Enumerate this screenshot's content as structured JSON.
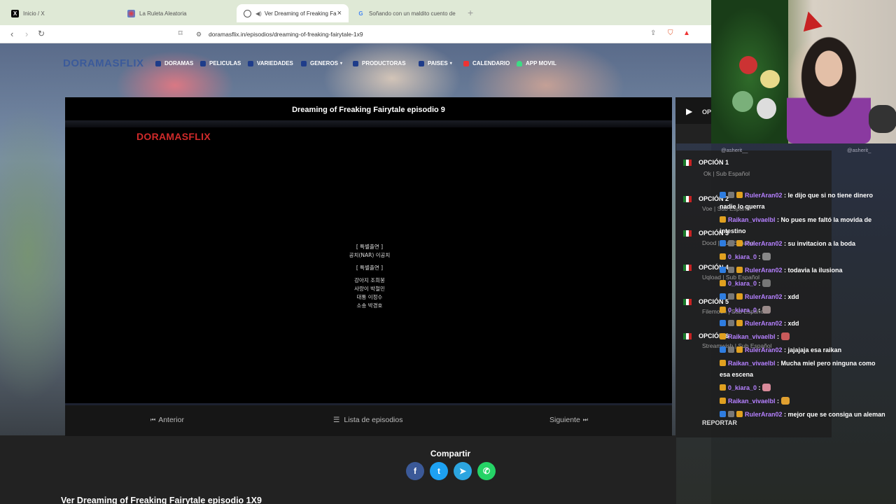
{
  "browser": {
    "tabs": [
      {
        "label": "Inicio / X",
        "icon": "x-logo-icon"
      },
      {
        "label": "La Ruleta Aleatoria",
        "icon": "roulette-icon"
      },
      {
        "label": "Ver Dreaming of Freaking Fa",
        "icon": "globe-icon",
        "active": true
      },
      {
        "label": "Soñando con un maldito cuento de",
        "icon": "google-icon"
      }
    ],
    "new_tab": "+",
    "url": "doramasflix.in/episodios/dreaming-of-freaking-fairytale-1x9"
  },
  "site": {
    "logo": "DORAMASFLIX",
    "menu": [
      "DORAMAS",
      "PELICULAS",
      "VARIEDADES",
      "GENEROS",
      "PRODUCTORAS",
      "PAISES",
      "CALENDARIO",
      "APP MOVIL"
    ]
  },
  "player": {
    "title": "Dreaming of Freaking Fairytale episodio 9",
    "watermark": "DORAMASFLIX",
    "credits": [
      "[ 특별출연 ]",
      "공치(NAR)    이공치",
      "[ 특별출연 ]",
      "강아지    조희봉",
      "사랑이    박철민",
      "대통    이정수",
      "소송    박경호"
    ]
  },
  "pager": {
    "prev": "Anterior",
    "list": "Lista de episodios",
    "next": "Siguiente"
  },
  "options_panel": {
    "head": "OP",
    "items": [
      {
        "label": "OPCIÓN 1",
        "sub": "Ok | Sub Español"
      },
      {
        "label": "OPCIÓN 2",
        "sub": "Voe | Sub Español"
      },
      {
        "label": "OPCIÓN 3",
        "sub": "Dood | Sub Español"
      },
      {
        "label": "OPCIÓN 4",
        "sub": "Uqload | Sub Español"
      },
      {
        "label": "OPCIÓN 5",
        "sub": "Filemoon | Sub Español"
      },
      {
        "label": "OPCIÓN 6",
        "sub": "Streamwish | Sub Español"
      }
    ],
    "report": "REPORTAR"
  },
  "share": {
    "title": "Compartir",
    "buttons": [
      {
        "name": "facebook",
        "glyph": "f",
        "color": "#3b5998"
      },
      {
        "name": "twitter",
        "glyph": "t",
        "color": "#1da1f2"
      },
      {
        "name": "telegram",
        "glyph": "➤",
        "color": "#2ca5e0"
      },
      {
        "name": "whatsapp",
        "glyph": "✆",
        "color": "#25d366"
      }
    ]
  },
  "page_heading": "Ver Dreaming of Freaking Fairytale episodio 1X9",
  "stream": {
    "handles": [
      "@asherit__",
      "@asherit_"
    ],
    "chat": [
      {
        "user": "RulerAran02",
        "color": "#b580ff",
        "text": ": le dijo que si no tiene dinero nadie lo querra"
      },
      {
        "user": "Raikan_vivaelbl",
        "color": "#b580ff",
        "text": ": No pues me faltó la movida de intestino"
      },
      {
        "user": "RulerAran02",
        "color": "#b580ff",
        "text": ": su invitacion a la boda"
      },
      {
        "user": "0_kiara_0",
        "color": "#b580ff",
        "text": ":",
        "emote": "#888"
      },
      {
        "user": "RulerAran02",
        "color": "#b580ff",
        "text": ": todavia la ilusiona"
      },
      {
        "user": "0_kiara_0",
        "color": "#b580ff",
        "text": ":",
        "emote": "#777"
      },
      {
        "user": "RulerAran02",
        "color": "#b580ff",
        "text": ": xdd"
      },
      {
        "user": "0_kiara_0",
        "color": "#b580ff",
        "text": ":",
        "emote": "#9a8a8a"
      },
      {
        "user": "RulerAran02",
        "color": "#b580ff",
        "text": ": xdd"
      },
      {
        "user": "Raikan_vivaelbl",
        "color": "#b580ff",
        "text": ":",
        "emote": "#c95a5a"
      },
      {
        "user": "RulerAran02",
        "color": "#b580ff",
        "text": ": jajajaja esa raikan"
      },
      {
        "user": "Raikan_vivaelbl",
        "color": "#b580ff",
        "text": ": Mucha miel pero ninguna como esa escena"
      },
      {
        "user": "0_kiara_0",
        "color": "#b580ff",
        "text": ":",
        "emote": "#d98a9a"
      },
      {
        "user": "Raikan_vivaelbl",
        "color": "#b580ff",
        "text": ":",
        "emote": "#e0a030"
      },
      {
        "user": "RulerAran02",
        "color": "#b580ff",
        "text": ": mejor que se consiga un aleman"
      }
    ]
  }
}
